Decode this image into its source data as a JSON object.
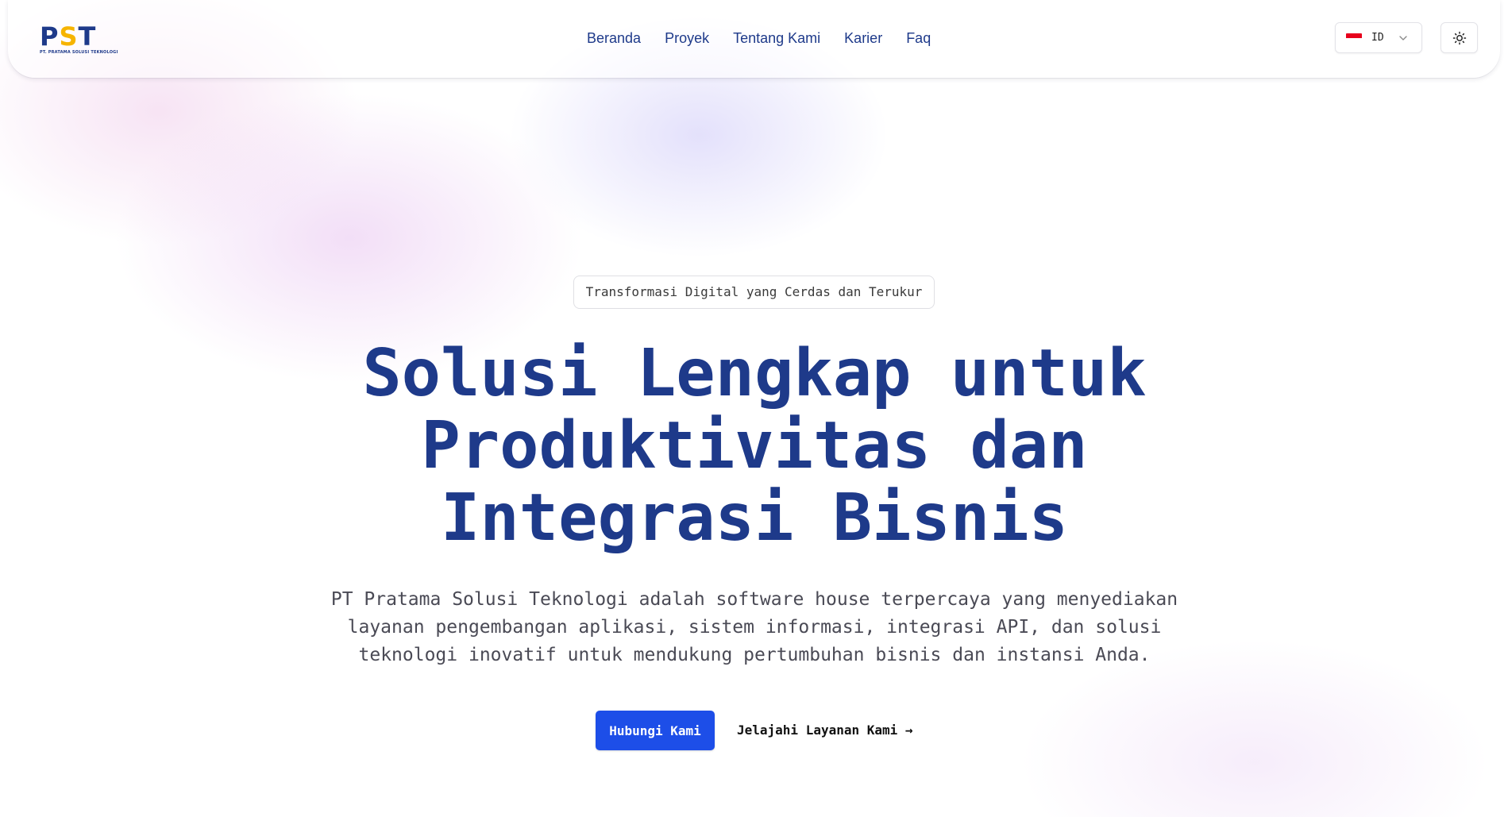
{
  "header": {
    "logo": {
      "mark_p": "P",
      "mark_s": "S",
      "mark_t": "T",
      "subtitle": "PT. PRATAMA SOLUSI TEKNOLOGI"
    },
    "nav": [
      {
        "label": "Beranda"
      },
      {
        "label": "Proyek"
      },
      {
        "label": "Tentang Kami"
      },
      {
        "label": "Karier"
      },
      {
        "label": "Faq"
      }
    ],
    "language": {
      "selected": "ID",
      "flag": "indonesia-flag",
      "icon": "chevron-down-icon"
    },
    "theme_toggle": {
      "icon": "sun-icon"
    }
  },
  "hero": {
    "badge": "Transformasi Digital yang Cerdas dan Terukur",
    "headline": [
      "Solusi Lengkap untuk",
      "Produktivitas dan",
      "Integrasi Bisnis"
    ],
    "description": [
      "PT Pratama Solusi Teknologi adalah software house terpercaya yang menyediakan",
      "layanan pengembangan aplikasi, sistem informasi, integrasi API, dan solusi",
      "teknologi inovatif untuk mendukung pertumbuhan bisnis dan instansi Anda."
    ],
    "primary_cta": "Hubungi Kami",
    "secondary_cta": "Jelajahi Layanan Kami →"
  },
  "colors": {
    "brand_navy": "#1e3a8a",
    "brand_yellow": "#f6b400",
    "primary_button": "#1d4ee8"
  }
}
